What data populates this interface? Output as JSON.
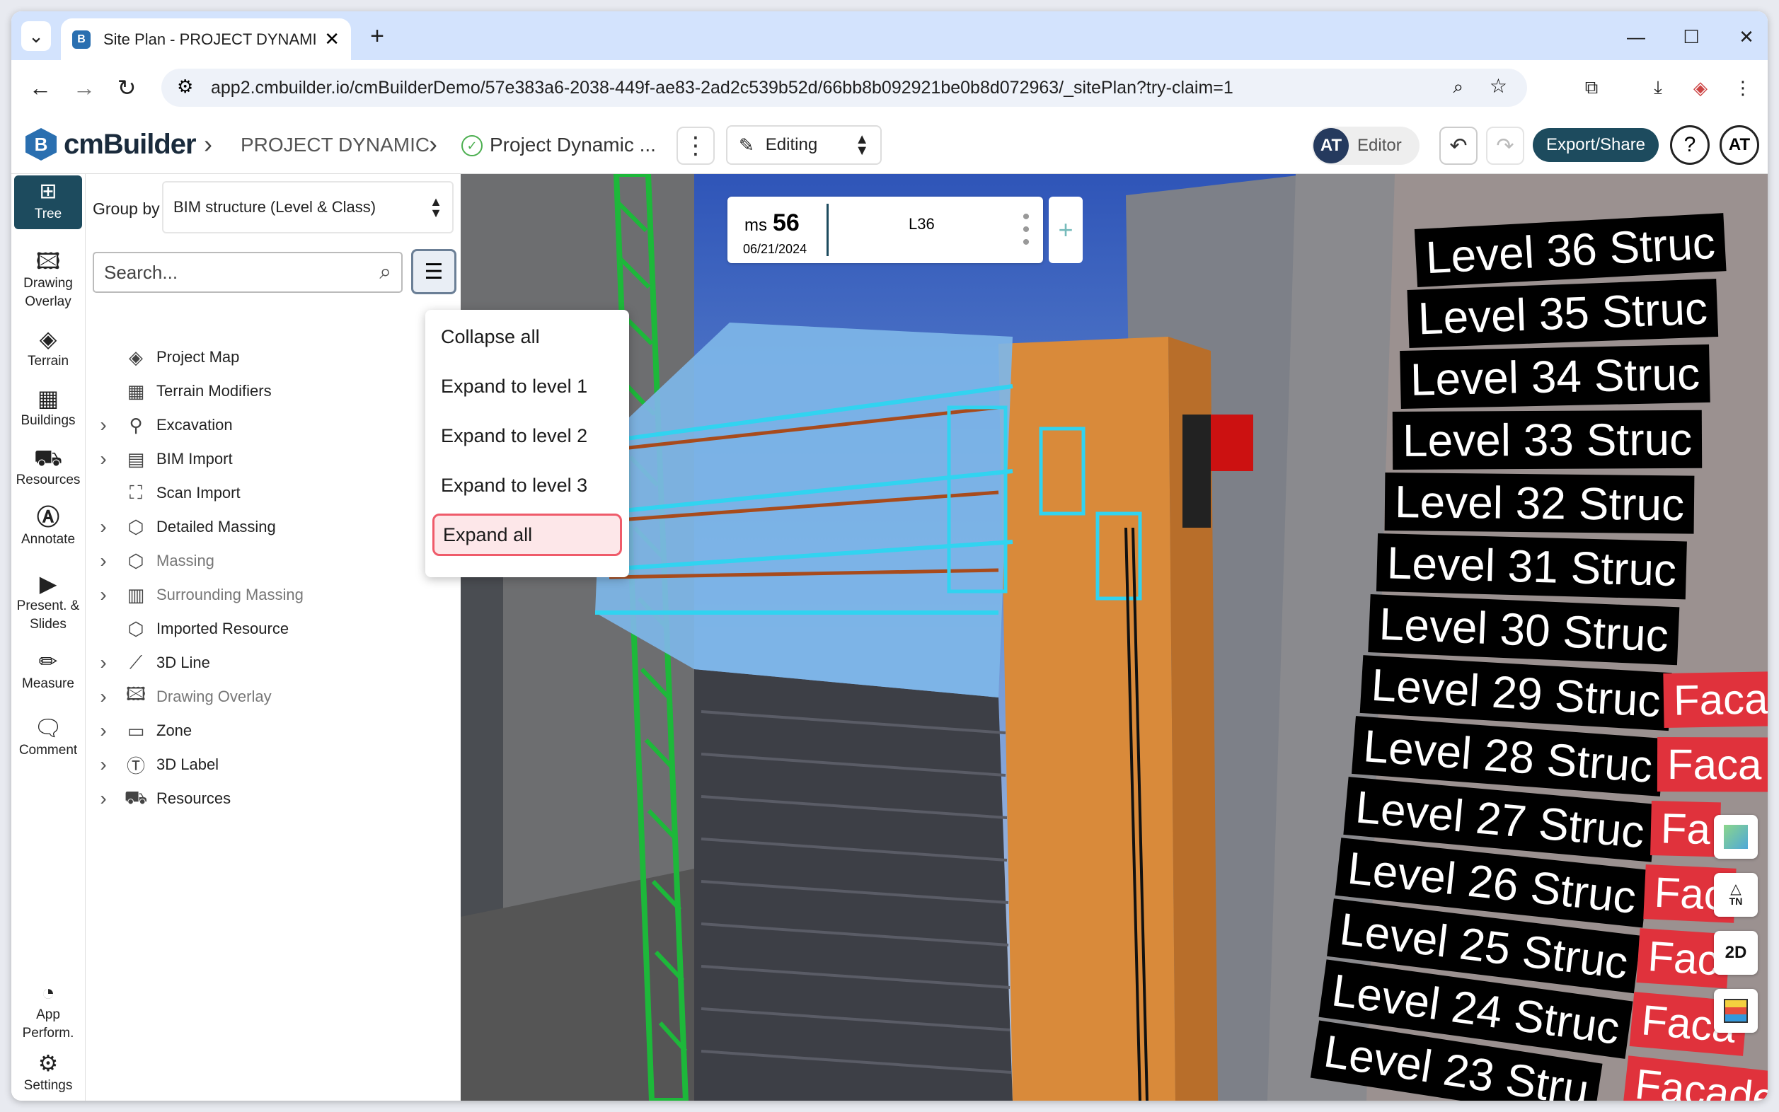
{
  "browser": {
    "tab_title": "Site Plan - PROJECT DYNAMIC",
    "new_tab": "+",
    "url": "app2.cmbuilder.io/cmBuilderDemo/57e383a6-2038-449f-ae83-2ad2c539b52d/66bb8b092921be0b8d072963/_sitePlan?try-claim=1"
  },
  "app": {
    "logo_text": "cmBuilder",
    "logo_mark": "B",
    "breadcrumb_project": "PROJECT DYNAMIC",
    "breadcrumb_scene": "Project Dynamic ...",
    "mode": "Editing",
    "role_initials": "AT",
    "role_label": "Editor",
    "export_label": "Export/Share",
    "help": "?",
    "user_initials": "AT"
  },
  "rail": [
    {
      "label": "Tree",
      "icon": "tree-icon"
    },
    {
      "label": "Drawing Overlay",
      "icon": "image-icon"
    },
    {
      "label": "Terrain",
      "icon": "terrain-icon"
    },
    {
      "label": "Buildings",
      "icon": "building-icon"
    },
    {
      "label": "Resources",
      "icon": "resources-icon"
    },
    {
      "label": "Annotate",
      "icon": "annotate-icon"
    },
    {
      "label": "Present. & Slides",
      "icon": "presentation-icon"
    },
    {
      "label": "Measure",
      "icon": "ruler-icon"
    },
    {
      "label": "Comment",
      "icon": "comment-icon"
    },
    {
      "label": "App Perform.",
      "icon": "gauge-icon"
    },
    {
      "label": "Settings",
      "icon": "settings-icon"
    }
  ],
  "panel": {
    "group_by_label": "Group by",
    "group_by_value": "BIM structure (Level & Class)",
    "search_placeholder": "Search...",
    "items": [
      {
        "label": "Project Map",
        "expandable": false,
        "dim": false
      },
      {
        "label": "Terrain Modifiers",
        "expandable": false,
        "dim": false
      },
      {
        "label": "Excavation",
        "expandable": true,
        "dim": false
      },
      {
        "label": "BIM Import",
        "expandable": true,
        "dim": false
      },
      {
        "label": "Scan Import",
        "expandable": false,
        "dim": false
      },
      {
        "label": "Detailed Massing",
        "expandable": true,
        "dim": false
      },
      {
        "label": "Massing",
        "expandable": true,
        "dim": true
      },
      {
        "label": "Surrounding Massing",
        "expandable": true,
        "dim": true
      },
      {
        "label": "Imported Resource",
        "expandable": false,
        "dim": false
      },
      {
        "label": "3D Line",
        "expandable": true,
        "dim": false
      },
      {
        "label": "Drawing Overlay",
        "expandable": true,
        "dim": true
      },
      {
        "label": "Zone",
        "expandable": true,
        "dim": false
      },
      {
        "label": "3D Label",
        "expandable": true,
        "dim": false
      },
      {
        "label": "Resources",
        "expandable": true,
        "dim": false
      }
    ]
  },
  "menu": [
    {
      "label": "Collapse all",
      "active": false
    },
    {
      "label": "Expand to level 1",
      "active": false
    },
    {
      "label": "Expand to level 2",
      "active": false
    },
    {
      "label": "Expand to level 3",
      "active": false
    },
    {
      "label": "Expand all",
      "active": true
    }
  ],
  "timeline": {
    "ms_prefix": "ms",
    "ms_value": "56",
    "date": "06/21/2024",
    "level": "L36",
    "add": "+"
  },
  "viewport": {
    "level_labels": [
      "Level 36 Struc",
      "Level 35 Struc",
      "Level 34 Struc",
      "Level 33 Struc",
      "Level 32 Struc",
      "Level 31 Struc",
      "Level 30 Struc",
      "Level 29 Struc",
      "Level 28 Struc",
      "Level 27 Struc",
      "Level 26 Struc",
      "Level 25 Struc",
      "Level 24 Struc",
      "Level 23 Stru"
    ],
    "facade_labels": [
      "Faca",
      "Faca",
      "Fa",
      "Fac",
      "Fac",
      "Faca",
      "Facade"
    ],
    "north_label": "TN",
    "view_2d": "2D"
  }
}
